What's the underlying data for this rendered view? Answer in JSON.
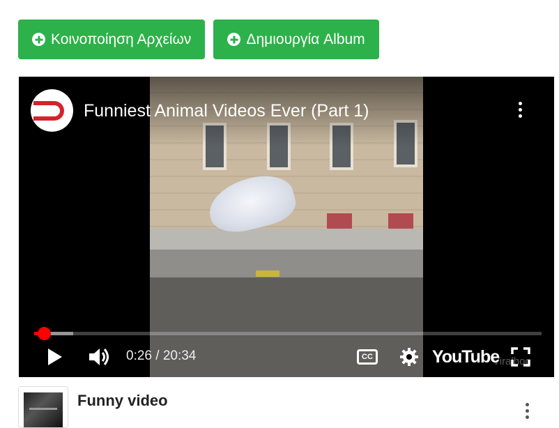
{
  "actions": {
    "share_files_label": "Κοινοποίηση Αρχείων",
    "create_album_label": "Δημιουργία Album"
  },
  "player": {
    "video_title": "Funniest Animal Videos Ever (Part 1)",
    "channel_logo_icon": "magnet-logo-icon",
    "more_icon": "more-vert-icon",
    "time_current": "0:26",
    "time_separator": " / ",
    "time_total": "20:34",
    "progress_played_fraction": 0.019,
    "progress_buffered_fraction": 0.077,
    "controls": [
      "play-icon",
      "volume-icon",
      "closed-captions-icon",
      "settings-gear-icon",
      "youtube-logo",
      "fullscreen-icon"
    ],
    "cc_label": "CC",
    "youtube_wordmark": "YouTube",
    "watermark": "Viralhog"
  },
  "item": {
    "title": "Funny video"
  },
  "colors": {
    "button_green": "#2db14a",
    "progress_red": "#ff0000",
    "logo_red": "#d6222a"
  }
}
